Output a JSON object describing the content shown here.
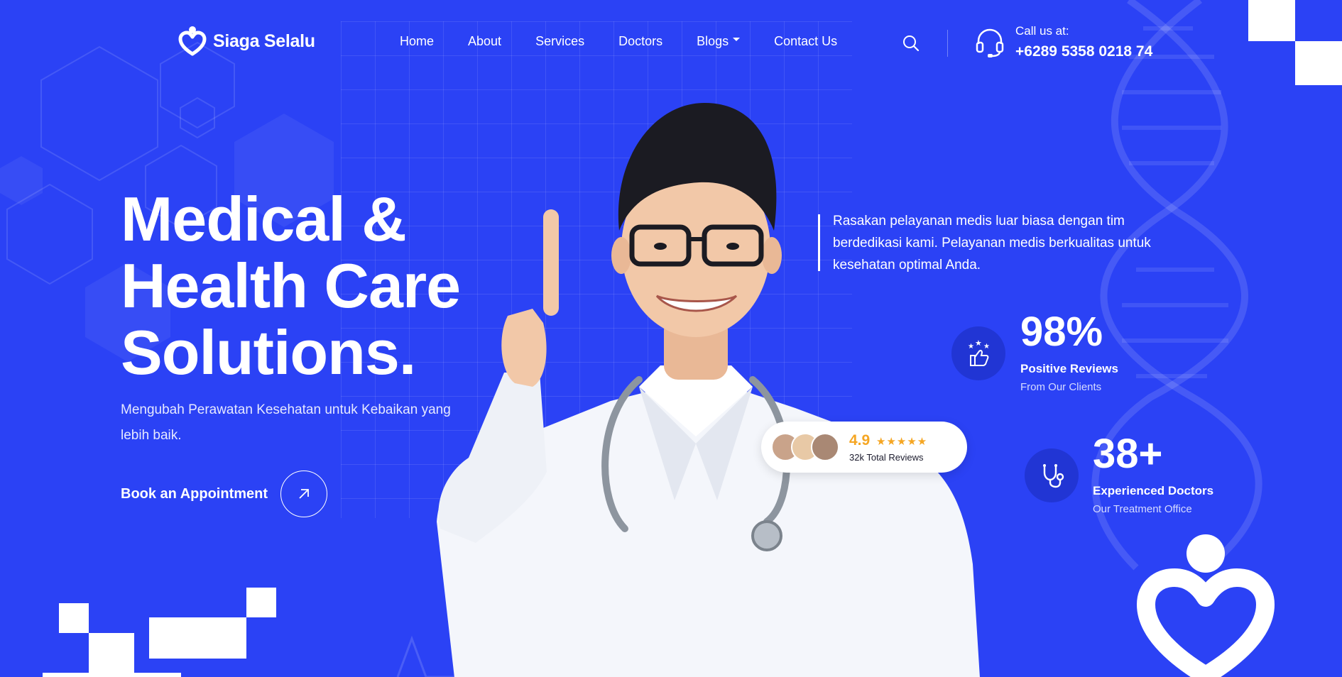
{
  "brand": {
    "name": "Siaga Selalu"
  },
  "nav": {
    "items": [
      {
        "label": "Home"
      },
      {
        "label": "About"
      },
      {
        "label": "Services"
      },
      {
        "label": "Doctors"
      },
      {
        "label": "Blogs",
        "has_dropdown": true
      },
      {
        "label": "Contact Us"
      }
    ]
  },
  "header": {
    "call_label": "Call us at:",
    "phone": "+6289 5358 0218 74"
  },
  "hero": {
    "title_lines": [
      "Medical &",
      "Health Care",
      "Solutions."
    ],
    "subtitle": "Mengubah Perawatan Kesehatan untuk Kebaikan yang lebih baik.",
    "cta_label": "Book an Appointment"
  },
  "description": "Rasakan pelayanan medis luar biasa dengan tim berdedikasi kami. Pelayanan medis berkualitas untuk kesehatan optimal Anda.",
  "stats": [
    {
      "value": "98%",
      "title": "Positive Reviews",
      "sub": "From Our Clients",
      "icon": "thumbs-up-stars-icon"
    },
    {
      "value": "38+",
      "title": "Experienced Doctors",
      "sub": "Our Treatment Office",
      "icon": "stethoscope-icon"
    }
  ],
  "rating": {
    "score": "4.9",
    "stars": "★★★★★",
    "label": "32k Total Reviews"
  },
  "colors": {
    "background": "#2b42f5",
    "accent_star": "#f5a623",
    "stat_icon_bg": "#2135d4"
  }
}
